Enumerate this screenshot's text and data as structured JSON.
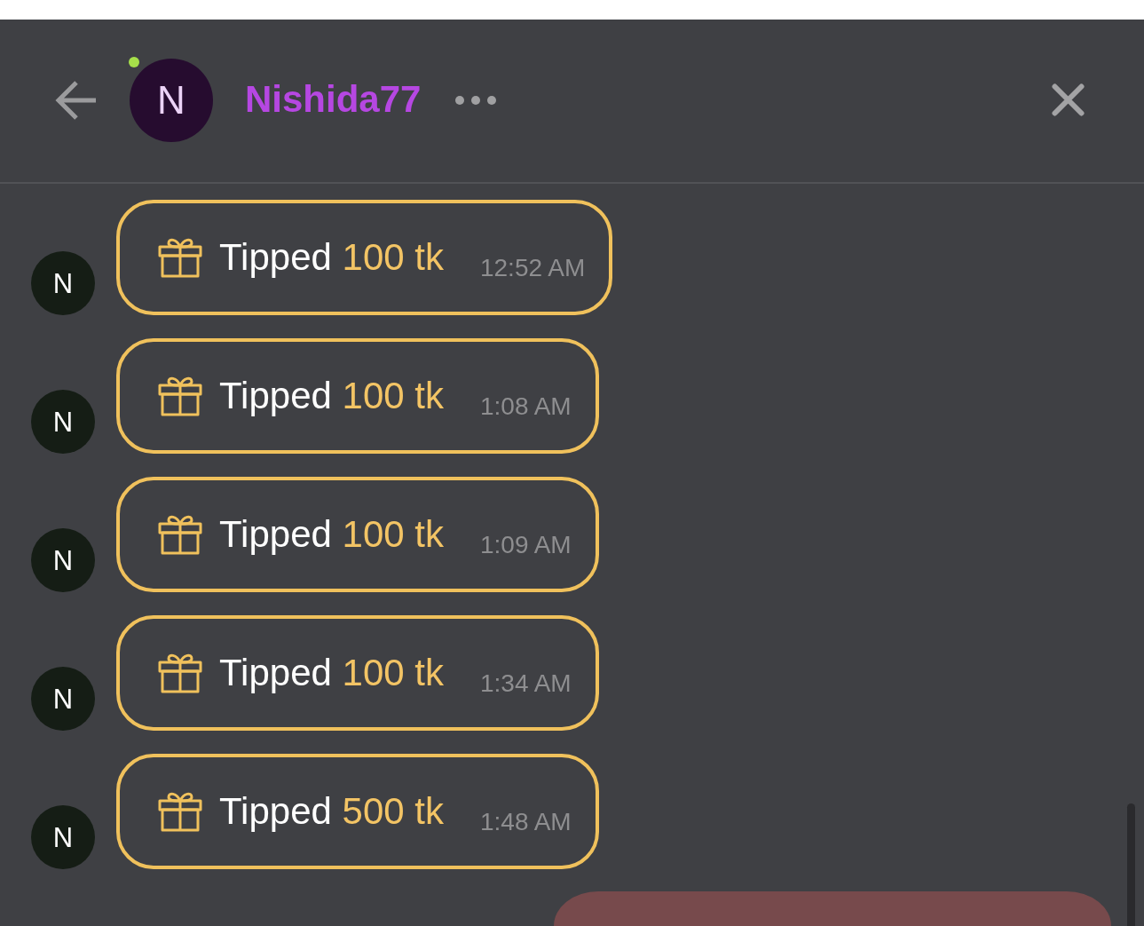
{
  "header": {
    "avatar_initial": "N",
    "online": true,
    "name": "Nishida77"
  },
  "messages": [
    {
      "kind": "tip",
      "sender_initial": "N",
      "text": "Tipped",
      "amount": "100 tk",
      "time": "12:52 AM"
    },
    {
      "kind": "tip",
      "sender_initial": "N",
      "text": "Tipped",
      "amount": "100 tk",
      "time": "1:08 AM"
    },
    {
      "kind": "tip",
      "sender_initial": "N",
      "text": "Tipped",
      "amount": "100 tk",
      "time": "1:09 AM"
    },
    {
      "kind": "tip",
      "sender_initial": "N",
      "text": "Tipped",
      "amount": "100 tk",
      "time": "1:34 AM"
    },
    {
      "kind": "tip",
      "sender_initial": "N",
      "text": "Tipped",
      "amount": "500 tk",
      "time": "1:48 AM"
    },
    {
      "kind": "outgoing"
    }
  ]
}
